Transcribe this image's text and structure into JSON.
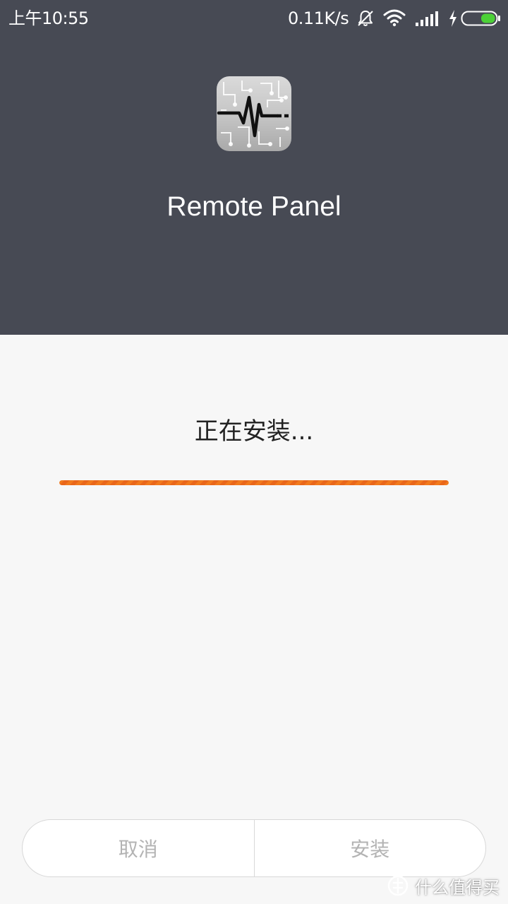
{
  "status_bar": {
    "time": "上午10:55",
    "network_speed": "0.11K/s",
    "icons": [
      "bell-muted-icon",
      "wifi-icon",
      "signal-icon",
      "charging-icon",
      "battery-icon"
    ]
  },
  "app": {
    "name": "Remote Panel",
    "icon": "pulse-circuit-icon"
  },
  "install": {
    "status_text": "正在安装...",
    "progress": 1.0
  },
  "buttons": {
    "cancel_label": "取消",
    "install_label": "安装"
  },
  "watermark": {
    "text": "什么值得买",
    "logo": "smzdm-logo"
  },
  "colors": {
    "header_bg": "#474a54",
    "body_bg": "#f7f7f7",
    "progress_accent": "#f17a1c",
    "battery_green": "#4cd137"
  }
}
